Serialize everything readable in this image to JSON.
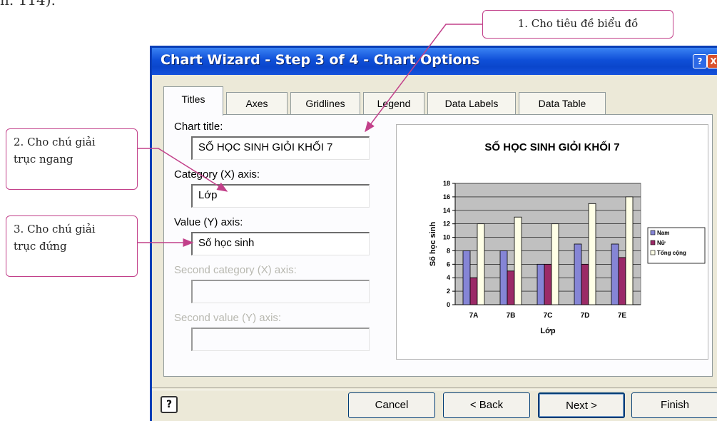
{
  "corner_text": "h. 114).",
  "dialog": {
    "title": "Chart Wizard - Step 3 of 4 - Chart Options",
    "help_icon": "?",
    "close_icon": "X",
    "tabs": [
      "Titles",
      "Axes",
      "Gridlines",
      "Legend",
      "Data Labels",
      "Data Table"
    ],
    "active_tab": "Titles",
    "fields": {
      "chart_title": {
        "label": "Chart title:",
        "value": "SỐ HỌC SINH GIỎI KHỐI 7"
      },
      "category_x": {
        "label": "Category (X) axis:",
        "value": "Lớp"
      },
      "value_y": {
        "label": "Value (Y) axis:",
        "value": "Số học sinh"
      },
      "second_category_x": {
        "label": "Second category (X) axis:",
        "value": ""
      },
      "second_value_y": {
        "label": "Second value (Y) axis:",
        "value": ""
      }
    },
    "buttons": {
      "help": "?",
      "cancel": "Cancel",
      "back": "< Back",
      "next": "Next >",
      "finish": "Finish"
    }
  },
  "callouts": {
    "c1": "1. Cho tiêu đề biểu đồ",
    "c2_line1": "2. Cho chú giải",
    "c2_line2": "trục ngang",
    "c3_line1": "3. Cho chú giải",
    "c3_line2": "trục đứng"
  },
  "chart_data": {
    "type": "bar",
    "title": "SỐ HỌC SINH GIỎI KHỐI 7",
    "xlabel": "Lớp",
    "ylabel": "Số học sinh",
    "categories": [
      "7A",
      "7B",
      "7C",
      "7D",
      "7E"
    ],
    "series": [
      {
        "name": "Nam",
        "values": [
          8,
          8,
          6,
          9,
          9
        ],
        "color": "#8585d6"
      },
      {
        "name": "Nữ",
        "values": [
          4,
          5,
          6,
          6,
          7
        ],
        "color": "#9b2a66"
      },
      {
        "name": "Tổng cộng",
        "values": [
          12,
          13,
          12,
          15,
          16
        ],
        "color": "#ffffe6"
      }
    ],
    "ylim": [
      0,
      18
    ],
    "yticks": [
      "0",
      "2",
      "4",
      "6",
      "8",
      "10",
      "12",
      "14",
      "16",
      "18"
    ],
    "grid": true,
    "plot_background": "#c0c0c0",
    "legend_position": "right"
  }
}
